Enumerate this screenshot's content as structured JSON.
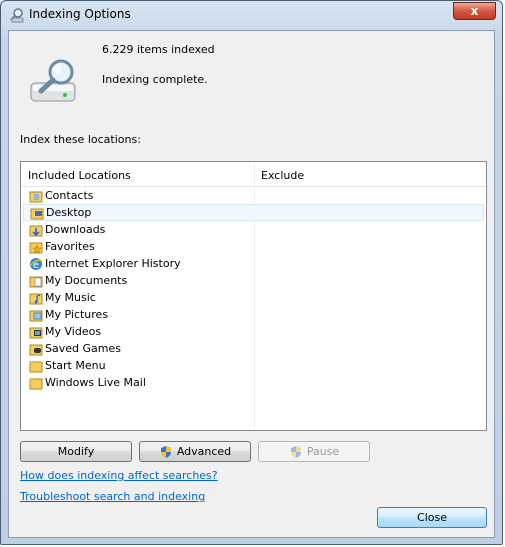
{
  "window": {
    "title": "Indexing Options",
    "close_glyph": "x"
  },
  "status": {
    "items_indexed": "6.229 items indexed",
    "state": "Indexing complete."
  },
  "locations_label": "Index these locations:",
  "list": {
    "headers": {
      "included": "Included Locations",
      "exclude": "Exclude"
    },
    "items": [
      {
        "label": "Contacts",
        "icon": "contacts-folder-icon"
      },
      {
        "label": "Desktop",
        "icon": "desktop-folder-icon"
      },
      {
        "label": "Downloads",
        "icon": "downloads-folder-icon"
      },
      {
        "label": "Favorites",
        "icon": "favorites-folder-icon"
      },
      {
        "label": "Internet Explorer History",
        "icon": "internet-explorer-icon"
      },
      {
        "label": "My Documents",
        "icon": "documents-folder-icon"
      },
      {
        "label": "My Music",
        "icon": "music-folder-icon"
      },
      {
        "label": "My Pictures",
        "icon": "pictures-folder-icon"
      },
      {
        "label": "My Videos",
        "icon": "videos-folder-icon"
      },
      {
        "label": "Saved Games",
        "icon": "games-folder-icon"
      },
      {
        "label": "Start Menu",
        "icon": "folder-icon"
      },
      {
        "label": "Windows Live Mail",
        "icon": "folder-icon"
      }
    ],
    "selected_index": 1
  },
  "buttons": {
    "modify": "Modify",
    "advanced": "Advanced",
    "pause": "Pause",
    "close": "Close"
  },
  "links": {
    "indexing_help": "How does indexing affect searches?",
    "troubleshoot": "Troubleshoot search and indexing"
  },
  "colors": {
    "link": "#0066cc",
    "folder": "#f4cf5a",
    "selection": "#f2f7fd"
  }
}
